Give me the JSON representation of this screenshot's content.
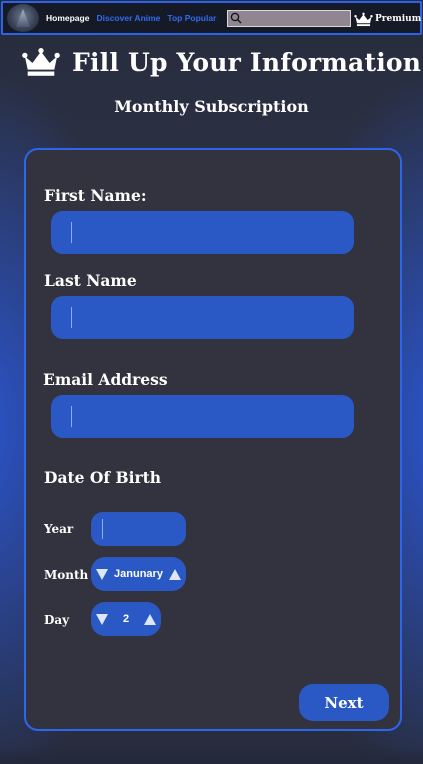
{
  "nav": {
    "home": "Homepage",
    "discover": "Discover Anime",
    "popular": "Top Popular",
    "search_value": "",
    "premium": "Premium"
  },
  "header": {
    "title": "Fill Up Your Information",
    "subtitle": "Monthly Subscription"
  },
  "form": {
    "first_name_label": "First Name:",
    "first_name_value": "",
    "last_name_label": "Last Name",
    "last_name_value": "",
    "email_label": "Email Address",
    "email_value": "",
    "dob_label": "Date Of Birth",
    "year_label": "Year",
    "year_value": "",
    "month_label": "Month",
    "month_value": "Janunary",
    "day_label": "Day",
    "day_value": "2",
    "next_label": "Next"
  },
  "colors": {
    "accent": "#2d66ee",
    "field": "#2a59c6",
    "card": "#33333f",
    "nav_link": "#2f6cf0"
  },
  "icons": {
    "logo": "anime-logo",
    "search": "search-icon",
    "crown": "crown-icon",
    "decrement": "triangle-down-icon",
    "increment": "triangle-up-icon"
  }
}
